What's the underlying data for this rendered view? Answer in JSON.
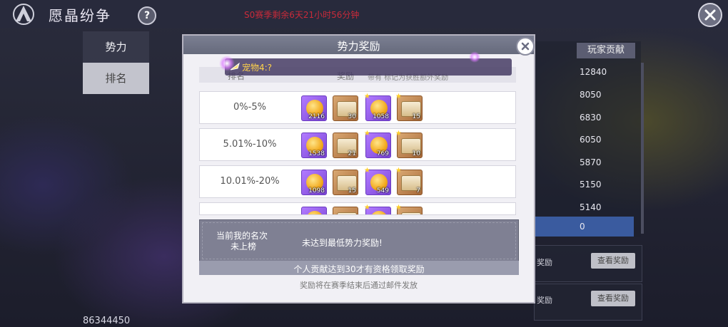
{
  "header": {
    "title": "愿晶纷争",
    "help_label": "?",
    "season_text": "S0赛季剩余6天21小时56分钟"
  },
  "left_tabs": [
    {
      "label": "势力"
    },
    {
      "label": "排名"
    }
  ],
  "bottom_score": "86344450",
  "contribution": {
    "header": "玩家贡献",
    "values": [
      "12840",
      "8050",
      "6830",
      "6050",
      "5870",
      "5150",
      "5140",
      "0"
    ]
  },
  "side_rewards": [
    {
      "text": "奖励",
      "button": "查看奖励"
    },
    {
      "text": "奖励",
      "button": "查看奖励"
    }
  ],
  "modal": {
    "title": "势力奖励",
    "pet_label": "宠物4:?",
    "col_rank": "排名",
    "col_reward": "奖励",
    "col_bonus": "带有   标记为获胜额外奖励",
    "rows": [
      {
        "range": "0%-5%",
        "items": [
          {
            "kind": "coin",
            "frame": "purple",
            "qty": "2116",
            "star": false
          },
          {
            "kind": "chest",
            "frame": "brown",
            "qty": "30",
            "star": false
          },
          {
            "kind": "coin",
            "frame": "purple",
            "qty": "1058",
            "star": true
          },
          {
            "kind": "chest",
            "frame": "brown",
            "qty": "15",
            "star": true
          }
        ]
      },
      {
        "range": "5.01%-10%",
        "items": [
          {
            "kind": "coin",
            "frame": "purple",
            "qty": "1538",
            "star": false
          },
          {
            "kind": "chest",
            "frame": "brown",
            "qty": "21",
            "star": false
          },
          {
            "kind": "coin",
            "frame": "purple",
            "qty": "769",
            "star": true
          },
          {
            "kind": "chest",
            "frame": "brown",
            "qty": "10",
            "star": true
          }
        ]
      },
      {
        "range": "10.01%-20%",
        "items": [
          {
            "kind": "coin",
            "frame": "purple",
            "qty": "1098",
            "star": false
          },
          {
            "kind": "chest",
            "frame": "brown",
            "qty": "15",
            "star": false
          },
          {
            "kind": "coin",
            "frame": "purple",
            "qty": "549",
            "star": true
          },
          {
            "kind": "chest",
            "frame": "brown",
            "qty": "7",
            "star": true
          }
        ]
      },
      {
        "range": "",
        "items": [
          {
            "kind": "coin",
            "frame": "purple",
            "qty": "",
            "star": false
          },
          {
            "kind": "chest",
            "frame": "brown",
            "qty": "",
            "star": false
          },
          {
            "kind": "coin",
            "frame": "purple",
            "qty": "",
            "star": true
          },
          {
            "kind": "chest",
            "frame": "brown",
            "qty": "",
            "star": true
          }
        ]
      }
    ],
    "my_rank_line1": "当前我的名次",
    "my_rank_line2": "未上榜",
    "my_message": "未达到最低势力奖励!",
    "requirement": "个人贡献达到30才有资格领取奖励",
    "footer": "奖励将在赛季结束后通过邮件发放"
  }
}
